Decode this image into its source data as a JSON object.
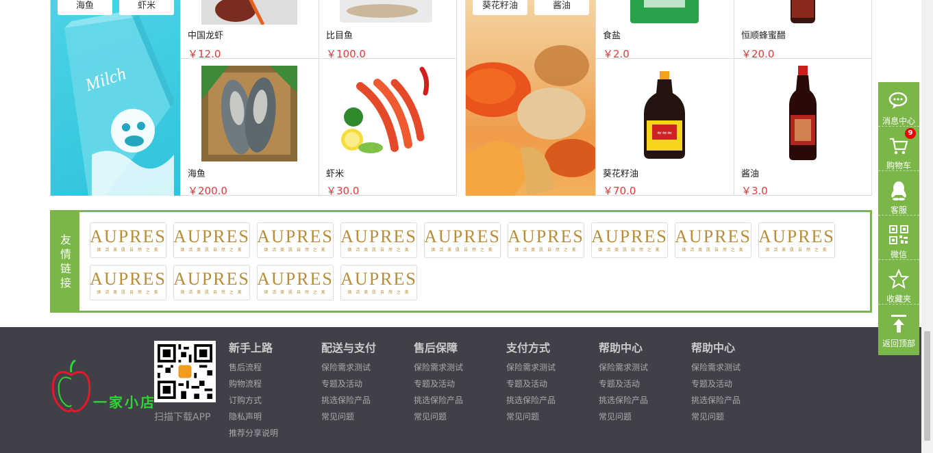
{
  "products": {
    "left": {
      "tags": [
        "海鱼",
        "虾米"
      ],
      "banner_text": "Milch",
      "items": [
        {
          "name": "中国龙虾",
          "price": "￥12.0"
        },
        {
          "name": "比目鱼",
          "price": "￥100.0"
        },
        {
          "name": "海鱼",
          "price": "￥200.0"
        },
        {
          "name": "虾米",
          "price": "￥30.0"
        }
      ]
    },
    "right": {
      "tags": [
        "葵花籽油",
        "酱油"
      ],
      "items": [
        {
          "name": "食盐",
          "price": "￥2.0"
        },
        {
          "name": "恒顺蜂蜜醋",
          "price": "￥20.0"
        },
        {
          "name": "葵花籽油",
          "price": "￥70.0"
        },
        {
          "name": "酱油",
          "price": "￥3.0"
        }
      ]
    }
  },
  "friend_links": {
    "label": "友情链接",
    "logos": [
      {
        "text": "AUPRES",
        "sub": "焕 活 美 肌   自 然 之 美"
      },
      {
        "text": "AUPRES",
        "sub": "焕 活 美 肌   自 然 之 美"
      },
      {
        "text": "AUPRES",
        "sub": "焕 活 美 肌   自 然 之 美"
      },
      {
        "text": "AUPRES",
        "sub": "焕 活 美 肌   自 然 之 美"
      },
      {
        "text": "AUPRES",
        "sub": "焕 活 美 肌   自 然 之 美"
      },
      {
        "text": "AUPRES",
        "sub": "焕 活 美 肌   自 然 之 美"
      },
      {
        "text": "AUPRES",
        "sub": "焕 活 美 肌   自 然 之 美"
      },
      {
        "text": "AUPRES",
        "sub": "焕 活 美 肌   自 然 之 美"
      },
      {
        "text": "AUPRES",
        "sub": "焕 活 美 肌   自 然 之 美"
      },
      {
        "text": "AUPRES",
        "sub": "焕 活 美 肌   自 然 之 美"
      },
      {
        "text": "AUPRES",
        "sub": "焕 活 美 肌   自 然 之 美"
      },
      {
        "text": "AUPRES",
        "sub": "焕 活 美 肌   自 然 之 美"
      },
      {
        "text": "AUPRES",
        "sub": "焕 活 美 肌   自 然 之 美"
      }
    ]
  },
  "footer": {
    "logo_text": "一家小店",
    "qr_label": "扫描下载APP",
    "columns": [
      {
        "title": "新手上路",
        "links": [
          "售后流程",
          "购物流程",
          "订购方式",
          "隐私声明",
          "推荐分享说明"
        ]
      },
      {
        "title": "配送与支付",
        "links": [
          "保险需求测试",
          "专题及活动",
          "挑选保险产品",
          "常见问题"
        ]
      },
      {
        "title": "售后保障",
        "links": [
          "保险需求测试",
          "专题及活动",
          "挑选保险产品",
          "常见问题"
        ]
      },
      {
        "title": "支付方式",
        "links": [
          "保险需求测试",
          "专题及活动",
          "挑选保险产品",
          "常见问题"
        ]
      },
      {
        "title": "帮助中心",
        "links": [
          "保险需求测试",
          "专题及活动",
          "挑选保险产品",
          "常见问题"
        ]
      },
      {
        "title": "帮助中心",
        "links": [
          "保险需求测试",
          "专题及活动",
          "挑选保险产品",
          "常见问题"
        ]
      }
    ]
  },
  "side_toolbar": {
    "items": [
      {
        "label": "消息中心",
        "icon": "chat-icon"
      },
      {
        "label": "购物车",
        "icon": "cart-icon",
        "badge": "9"
      },
      {
        "label": "客服",
        "icon": "qq-icon"
      },
      {
        "label": "微信",
        "icon": "qrcode-icon"
      },
      {
        "label": "收藏夹",
        "icon": "star-icon"
      },
      {
        "label": "返回顶部",
        "icon": "back-to-top-icon"
      }
    ]
  },
  "colors": {
    "accent_green": "#7ab648",
    "price_red": "#e4393c",
    "footer_bg": "#414048",
    "badge_red": "#e00000"
  }
}
